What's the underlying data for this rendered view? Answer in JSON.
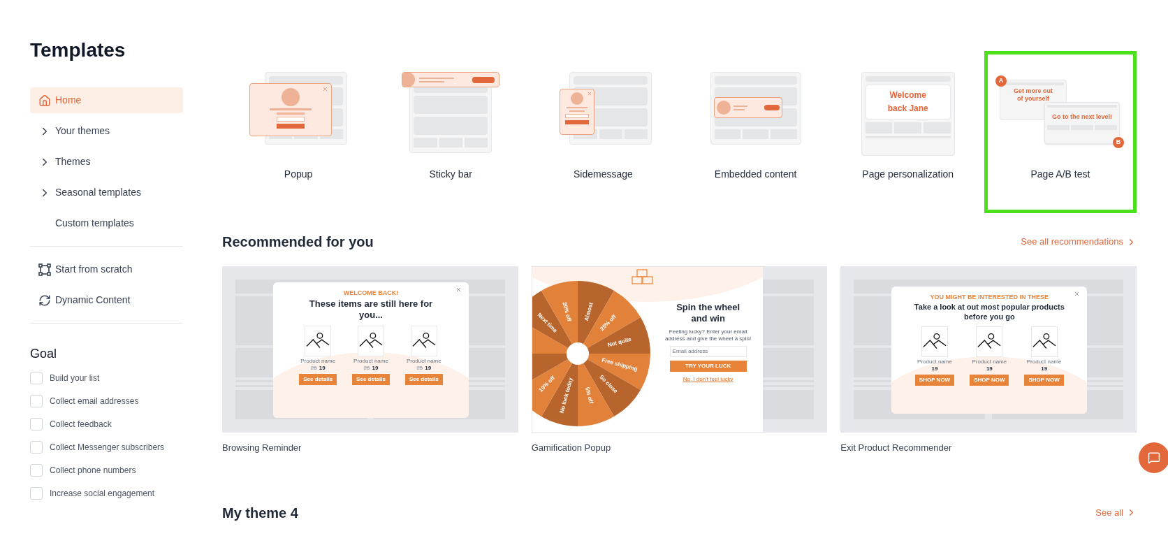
{
  "sidebar": {
    "title": "Templates",
    "nav": [
      {
        "label": "Home",
        "kind": "home",
        "selected": true
      },
      {
        "label": "Your themes",
        "kind": "expand",
        "selected": false
      },
      {
        "label": "Themes",
        "kind": "expand",
        "selected": false
      },
      {
        "label": "Seasonal templates",
        "kind": "expand",
        "selected": false
      },
      {
        "label": "Custom templates",
        "kind": "plain",
        "selected": false
      }
    ],
    "tools": [
      {
        "label": "Start from scratch",
        "kind": "scratch"
      },
      {
        "label": "Dynamic Content",
        "kind": "dynamic"
      }
    ],
    "goal": {
      "title": "Goal",
      "options": [
        {
          "label": "Build your list",
          "checked": false
        },
        {
          "label": "Collect email addresses",
          "checked": false
        },
        {
          "label": "Collect feedback",
          "checked": false
        },
        {
          "label": "Collect Messenger subscribers",
          "checked": false
        },
        {
          "label": "Collect phone numbers",
          "checked": false
        },
        {
          "label": "Increase social engagement",
          "checked": false
        }
      ]
    }
  },
  "types": [
    {
      "label": "Popup",
      "kind": "popup",
      "highlighted": false
    },
    {
      "label": "Sticky bar",
      "kind": "sticky",
      "highlighted": false
    },
    {
      "label": "Sidemessage",
      "kind": "side",
      "highlighted": false
    },
    {
      "label": "Embedded content",
      "kind": "embedded",
      "highlighted": false
    },
    {
      "label": "Page personalization",
      "kind": "personal",
      "highlighted": false,
      "texts": [
        "Welcome",
        "back Jane"
      ]
    },
    {
      "label": "Page A/B test",
      "kind": "abtest",
      "highlighted": true,
      "texts": [
        "A",
        "Get more out",
        "of yourself",
        "Go to the next level!",
        "B"
      ]
    }
  ],
  "recommended": {
    "title": "Recommended for you",
    "link": "See all recommendations",
    "cards": [
      {
        "kind": "products",
        "caption": "Browsing Reminder",
        "preview": {
          "eyebrow": "WELCOME BACK!",
          "headline": "These items are still here for you...",
          "products": [
            {
              "name": "Product name",
              "old_price": "25",
              "price": "19",
              "button": "See details"
            },
            {
              "name": "Product name",
              "old_price": "25",
              "price": "19",
              "button": "See details"
            },
            {
              "name": "Product name",
              "old_price": "25",
              "price": "19",
              "button": "See details"
            }
          ]
        }
      },
      {
        "kind": "wheel",
        "caption": "Gamification Popup",
        "preview": {
          "headline": "Spin the wheel and win",
          "body": "Feeling lucky? Enter your email address and give the wheel a spin!",
          "placeholder": "Email address",
          "button": "TRY YOUR LUCK",
          "link": "No, I don't feel lucky",
          "segments": [
            {
              "label": "Almost",
              "color": "#b8652d"
            },
            {
              "label": "25% off",
              "color": "#e2813a"
            },
            {
              "label": "Not quite",
              "color": "#b8652d"
            },
            {
              "label": "Free shipping",
              "color": "#e2813a"
            },
            {
              "label": "So close",
              "color": "#b8652d"
            },
            {
              "label": "5% off",
              "color": "#e2813a"
            },
            {
              "label": "No luck today",
              "color": "#b8652d"
            },
            {
              "label": "10% off",
              "color": "#e2813a"
            },
            {
              "color": "#b8652d"
            },
            {
              "color": "#e2813a"
            },
            {
              "label": "Next time",
              "color": "#b8652d"
            },
            {
              "label": "20% off",
              "color": "#e2813a"
            }
          ]
        }
      },
      {
        "kind": "products",
        "caption": "Exit Product Recommender",
        "preview": {
          "eyebrow": "YOU MIGHT BE INTERESTED IN THESE",
          "headline": "Take a look at out most popular products before you go",
          "products": [
            {
              "name": "Product name",
              "price": "19",
              "button": "SHOP NOW"
            },
            {
              "name": "Product name",
              "price": "19",
              "button": "SHOP NOW"
            },
            {
              "name": "Product name",
              "price": "19",
              "button": "SHOP NOW"
            }
          ]
        }
      }
    ]
  },
  "my_theme": {
    "title": "My theme 4",
    "link": "See all"
  }
}
